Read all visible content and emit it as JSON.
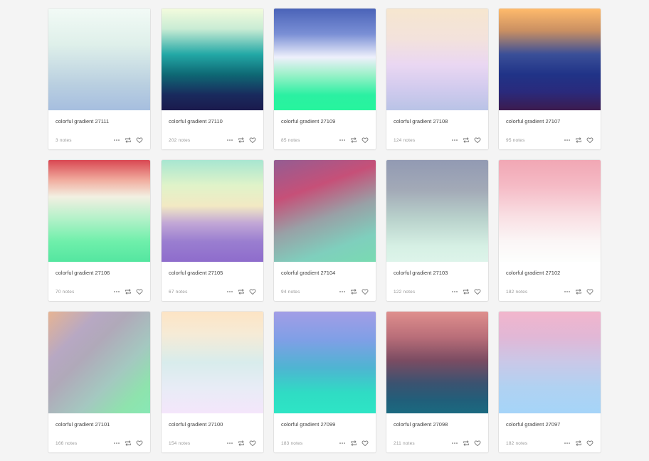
{
  "cards": [
    {
      "title": "colorful gradient 27111",
      "notes": "3 notes",
      "gradient": "linear-gradient(180deg,#f2faf6 0%,#dff0ea 35%,#b9cfe0 75%,#a6bedf 100%)"
    },
    {
      "title": "colorful gradient 27110",
      "notes": "202 notes",
      "gradient": "linear-gradient(180deg,#f3fbdd 0%,#c9ecd4 20%,#23a8a6 45%,#0e6874 65%,#192a5d 85%,#1b1a4d 100%)"
    },
    {
      "title": "colorful gradient 27109",
      "notes": "85 notes",
      "gradient": "linear-gradient(180deg,#4a63b8 0%,#7a8fd5 25%,#eef0fb 48%,#9bf1c9 65%,#2bf0a2 85%,#26f59d 100%)"
    },
    {
      "title": "colorful gradient 27108",
      "notes": "124 notes",
      "gradient": "linear-gradient(180deg,#f6e6cf 0%,#f3e2dc 30%,#ead7f2 55%,#d2cbee 78%,#b9c3e6 100%)"
    },
    {
      "title": "colorful gradient 27107",
      "notes": "95 notes",
      "gradient": "linear-gradient(180deg,#ffbb6c 0%,#c98f62 22%,#3a4f98 45%,#203387 65%,#2a2a7c 82%,#3c1b4e 100%)"
    },
    {
      "title": "colorful gradient 27106",
      "notes": "70 notes",
      "gradient": "linear-gradient(180deg,#d94752 0%,#f1aea0 20%,#f2f0e2 36%,#b2f1c8 58%,#6fefab 80%,#54e6a0 100%)"
    },
    {
      "title": "colorful gradient 27105",
      "notes": "67 notes",
      "gradient": "linear-gradient(180deg,#a7e6d1 0%,#e0f3c9 25%,#f2e9c3 45%,#c2a7d6 62%,#9a7ed0 80%,#8e6ccc 100%)"
    },
    {
      "title": "colorful gradient 27104",
      "notes": "94 notes",
      "gradient": "linear-gradient(160deg,#935d93 0%,#c65078 30%,#99a0a6 55%,#7fcfbd 80%,#79dbb1 100%)"
    },
    {
      "title": "colorful gradient 27103",
      "notes": "122 notes",
      "gradient": "linear-gradient(180deg,#929ab3 0%,#a3aab7 30%,#b9d2cc 58%,#d6f0e4 85%,#ddf4ea 100%)"
    },
    {
      "title": "colorful gradient 27102",
      "notes": "182 notes",
      "gradient": "linear-gradient(180deg,#f1a7b4 0%,#f5bac5 25%,#f9dfe3 55%,#fbf6f6 80%,#fdfefd 100%)"
    },
    {
      "title": "colorful gradient 27101",
      "notes": "166 notes",
      "gradient": "linear-gradient(135deg,#e6b493 0%,#b7a8c3 25%,#b0a9b9 40%,#a4c8c0 65%,#8ee3ad 85%,#88e8b5 100%)"
    },
    {
      "title": "colorful gradient 27100",
      "notes": "154 notes",
      "gradient": "linear-gradient(180deg,#fde4c4 0%,#f6ebd6 22%,#d8ecec 50%,#e8ecf6 75%,#f4e6fb 100%)"
    },
    {
      "title": "colorful gradient 27099",
      "notes": "183 notes",
      "gradient": "linear-gradient(180deg,#a29ee6 0%,#7f9fe6 28%,#4fb4d2 55%,#2fdcc4 80%,#2ee5c5 100%)"
    },
    {
      "title": "colorful gradient 27098",
      "notes": "211 notes",
      "gradient": "linear-gradient(180deg,#df8f8d 0%,#b96e79 25%,#7b4c62 48%,#3c5270 70%,#205f7a 88%,#1b6a80 100%)"
    },
    {
      "title": "colorful gradient 27097",
      "notes": "182 notes",
      "gradient": "linear-gradient(180deg,#f2b6cc 0%,#e1b7d6 25%,#c9c8e8 50%,#b0d2f2 75%,#a5d4f8 100%)"
    }
  ],
  "icons": {
    "more": "more-dots-icon",
    "reblog": "reblog-icon",
    "like": "heart-icon"
  }
}
